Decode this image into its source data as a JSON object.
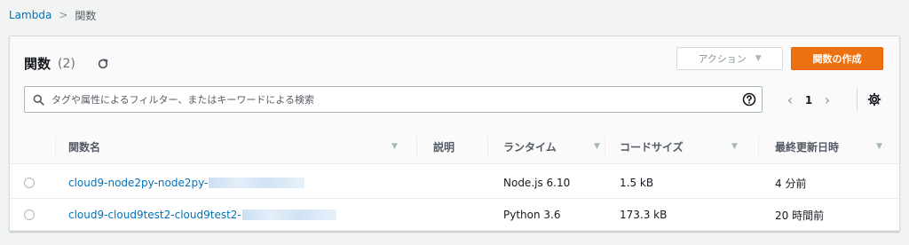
{
  "breadcrumb": {
    "root": "Lambda",
    "separator": ">",
    "current": "関数"
  },
  "header": {
    "title": "関数",
    "count": "(2)"
  },
  "actions": {
    "label": "アクション",
    "caret": "▼",
    "create_label": "関数の作成"
  },
  "search": {
    "placeholder": "タグや属性によるフィルター、またはキーワードによる検索",
    "value": ""
  },
  "pagination": {
    "prev": "‹",
    "page": "1",
    "next": "›"
  },
  "columns": [
    "関数名",
    "説明",
    "ランタイム",
    "コードサイズ",
    "最終更新日時"
  ],
  "sort_icon": "▼",
  "rows": [
    {
      "name": "cloud9-node2py-node2py-",
      "description": "",
      "runtime": "Node.js 6.10",
      "code_size": "1.5 kB",
      "last_modified": "4 分前"
    },
    {
      "name": "cloud9-cloud9test2-cloud9test2-",
      "description": "",
      "runtime": "Python 3.6",
      "code_size": "173.3 kB",
      "last_modified": "20 時間前"
    }
  ],
  "colors": {
    "accent": "#ec7211",
    "link": "#0073bb"
  }
}
